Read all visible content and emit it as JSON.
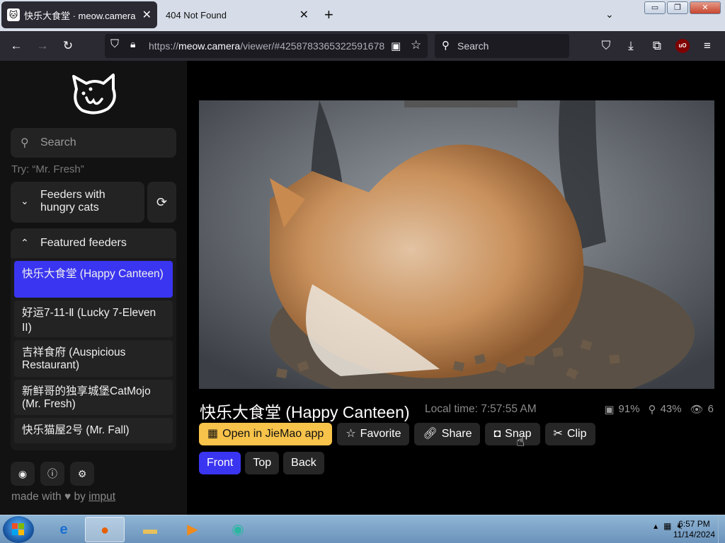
{
  "browser": {
    "tabs": [
      {
        "title": "快乐大食堂 · meow.camera",
        "active": true
      },
      {
        "title": "404 Not Found",
        "active": false
      }
    ],
    "new_tab_icon": "plus-icon",
    "tab_list_icon": "chevron-down-icon",
    "window_controls": {
      "minimize": "minimize-icon",
      "maximize": "maximize-icon",
      "close": "close-icon"
    },
    "nav": {
      "back_icon": "arrow-left-icon",
      "forward_icon": "arrow-right-icon",
      "reload_icon": "reload-icon",
      "url_prefix": "https://",
      "url_host": "meow.camera",
      "url_path": "/viewer/#4258783365322591678",
      "search_placeholder": "Search",
      "toolbar_icons": [
        "pocket-icon",
        "download-icon",
        "extensions-icon",
        "ublock-icon",
        "menu-icon"
      ],
      "ublock_label": "uO"
    }
  },
  "sidebar": {
    "logo": "cat-logo-icon",
    "search_placeholder": "Search",
    "hint": "Try: “Mr. Fresh”",
    "hungry_label": "Feeders with hungry cats",
    "featured_label": "Featured feeders",
    "feeders": [
      {
        "name": "快乐大食堂 (Happy Canteen)",
        "active": true
      },
      {
        "name": "好运7-11-Ⅱ (Lucky 7-Eleven II)",
        "active": false
      },
      {
        "name": "吉祥食府 (Auspicious Restaurant)",
        "active": false
      },
      {
        "name": "新鲜哥的独享城堡CatMojo (Mr. Fresh)",
        "active": false
      },
      {
        "name": "快乐猫屋2号 (Mr. Fall)",
        "active": false
      }
    ],
    "bottom_icons": [
      "discord-icon",
      "info-icon",
      "settings-icon"
    ],
    "footer_prefix": "made with",
    "footer_heart": "♥",
    "footer_by": "by",
    "footer_link": "imput"
  },
  "viewer": {
    "title": "快乐大食堂 (Happy Canteen)",
    "local_time": "Local time: 7:57:55 AM",
    "stats": {
      "food": "91%",
      "snack": "43%",
      "viewers": "6"
    },
    "actions": {
      "open_app": "Open in JieMao app",
      "favorite": "Favorite",
      "share": "Share",
      "snap": "Snap",
      "clip": "Clip"
    },
    "views": [
      "Front",
      "Top",
      "Back"
    ],
    "active_view": "Front"
  },
  "taskbar": {
    "apps": [
      "windows-start-icon",
      "internet-explorer-icon",
      "firefox-icon",
      "file-explorer-icon",
      "media-player-icon",
      "app-icon"
    ],
    "clock_time": "6:57 PM",
    "clock_date": "11/14/2024"
  },
  "colors": {
    "accent": "#3a35f0",
    "primary_button": "#f8c34a",
    "sidebar_bg": "#121212"
  }
}
